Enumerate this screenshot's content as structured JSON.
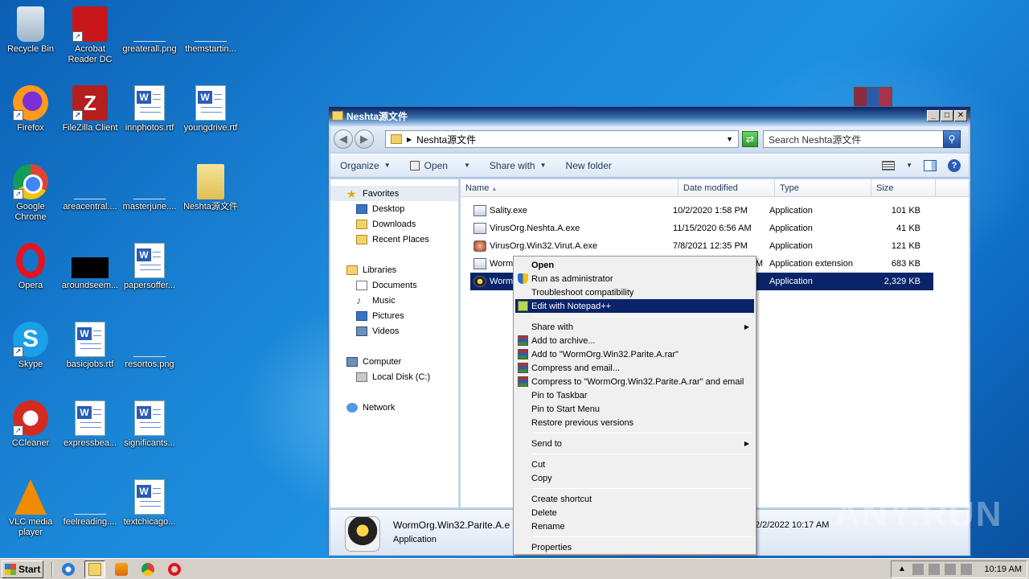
{
  "desktop": {
    "icons": [
      {
        "label": "Recycle Bin"
      },
      {
        "label": "Acrobat Reader DC"
      },
      {
        "label": "greaterall.png"
      },
      {
        "label": "themstartin..."
      },
      {
        "label": "Firefox"
      },
      {
        "label": "FileZilla Client"
      },
      {
        "label": "innphotos.rtf"
      },
      {
        "label": "youngdrive.rtf"
      },
      {
        "label": "Google Chrome"
      },
      {
        "label": "areacentral...."
      },
      {
        "label": "masterjune...."
      },
      {
        "label": "Neshta源文件"
      },
      {
        "label": "Opera"
      },
      {
        "label": "aroundseem..."
      },
      {
        "label": "papersoffer..."
      },
      {
        "label": "Skype"
      },
      {
        "label": "basicjobs.rtf"
      },
      {
        "label": "resortos.png"
      },
      {
        "label": "CCleaner"
      },
      {
        "label": "expressbea..."
      },
      {
        "label": "significants..."
      },
      {
        "label": "VLC media player"
      },
      {
        "label": "feelreading...."
      },
      {
        "label": "textchicago..."
      }
    ]
  },
  "window": {
    "title": "Neshta源文件",
    "address": "Neshta源文件",
    "search_placeholder": "Search Neshta源文件",
    "toolbar": {
      "organize": "Organize",
      "open": "Open",
      "share_with": "Share with",
      "new_folder": "New folder"
    },
    "nav": {
      "favorites": "Favorites",
      "desktop": "Desktop",
      "downloads": "Downloads",
      "recent_places": "Recent Places",
      "libraries": "Libraries",
      "documents": "Documents",
      "music": "Music",
      "pictures": "Pictures",
      "videos": "Videos",
      "computer": "Computer",
      "local_disk": "Local Disk (C:)",
      "network": "Network"
    },
    "columns": {
      "name": "Name",
      "date": "Date modified",
      "type": "Type",
      "size": "Size"
    },
    "files": [
      {
        "name": "Sality.exe",
        "date": "10/2/2020 1:58 PM",
        "type": "Application",
        "size": "101 KB"
      },
      {
        "name": "VirusOrg.Neshta.A.exe",
        "date": "11/15/2020 6:56 AM",
        "type": "Application",
        "size": "41 KB"
      },
      {
        "name": "VirusOrg.Win32.Virut.A.exe",
        "date": "7/8/2021 12:35 PM",
        "type": "Application",
        "size": "121 KB"
      },
      {
        "name": "Worm",
        "date": "M",
        "type": "Application extension",
        "size": "683 KB"
      },
      {
        "name": "Worm",
        "date": "",
        "type": "Application",
        "size": "2,329 KB"
      }
    ],
    "details": {
      "name": "WormOrg.Win32.Parite.A.e",
      "type": "Application",
      "date": "2/2/2022 10:17 AM"
    }
  },
  "context_menu": {
    "items": [
      "Open",
      "Run as administrator",
      "Troubleshoot compatibility",
      "Edit with Notepad++",
      "Share with",
      "Add to archive...",
      "Add to \"WormOrg.Win32.Parite.A.rar\"",
      "Compress and email...",
      "Compress to \"WormOrg.Win32.Parite.A.rar\" and email",
      "Pin to Taskbar",
      "Pin to Start Menu",
      "Restore previous versions",
      "Send to",
      "Cut",
      "Copy",
      "Create shortcut",
      "Delete",
      "Rename",
      "Properties"
    ]
  },
  "taskbar": {
    "start": "Start",
    "clock": "10:19 AM"
  },
  "watermark": "ANY.RUN",
  "colors": {
    "selection": "#0a246a",
    "desktop": "#1b86d6"
  }
}
